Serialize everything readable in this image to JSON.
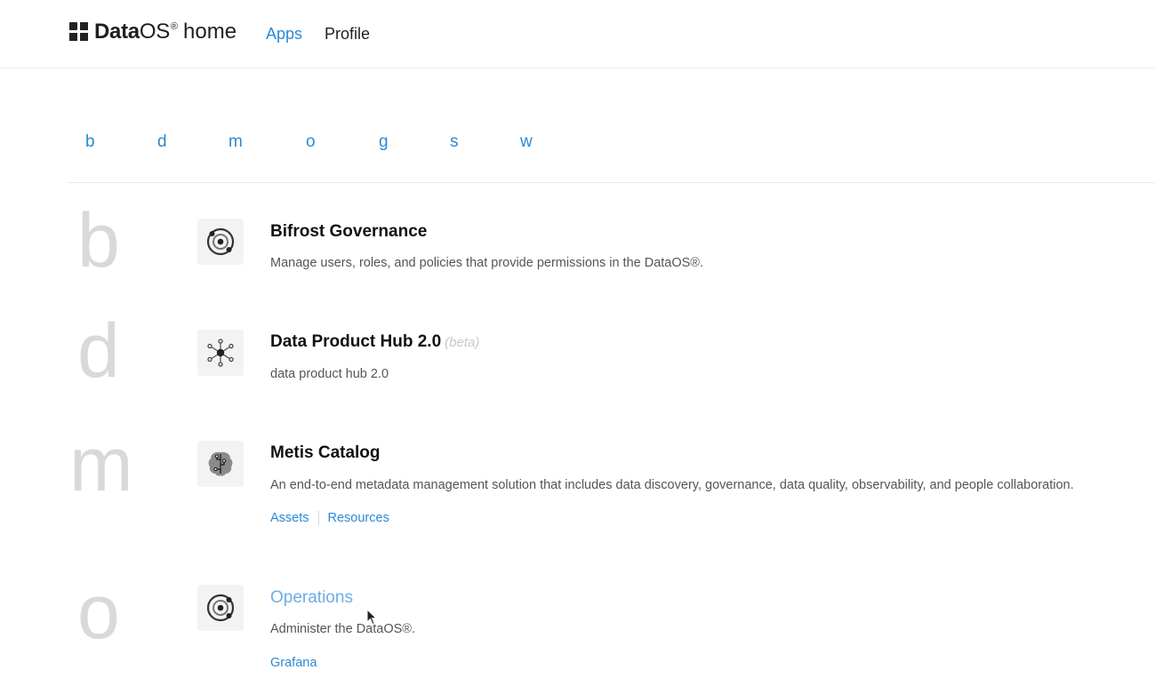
{
  "header": {
    "brand_bold": "Data",
    "brand_light": "OS",
    "brand_reg": "®",
    "brand_home": "home",
    "nav": [
      {
        "label": "Apps",
        "active": true
      },
      {
        "label": "Profile",
        "active": false
      }
    ]
  },
  "alphabet": [
    "b",
    "d",
    "m",
    "o",
    "g",
    "s",
    "w"
  ],
  "apps": [
    {
      "letter": "b",
      "icon": "orbit-target-icon",
      "title": "Bifrost Governance",
      "description": "Manage users, roles, and policies that provide permissions in the DataOS®."
    },
    {
      "letter": "d",
      "icon": "network-hub-icon",
      "title": "Data Product Hub 2.0",
      "badge": "(beta)",
      "description": "data product hub 2.0"
    },
    {
      "letter": "m",
      "icon": "brain-circuit-icon",
      "title": "Metis Catalog",
      "description": "An end-to-end metadata management solution that includes data discovery, governance, data quality, observability, and people collaboration.",
      "links": [
        "Assets",
        "Resources"
      ]
    },
    {
      "letter": "o",
      "icon": "orbit-target-icon",
      "title": "Operations",
      "description": "Administer the DataOS®.",
      "links": [
        "Grafana"
      ]
    }
  ],
  "colors": {
    "accent": "#2b8ad6",
    "hover_title": "#6aaee6",
    "group_letter": "#d9d9d9",
    "icon_tile": "#f3f3f3"
  }
}
